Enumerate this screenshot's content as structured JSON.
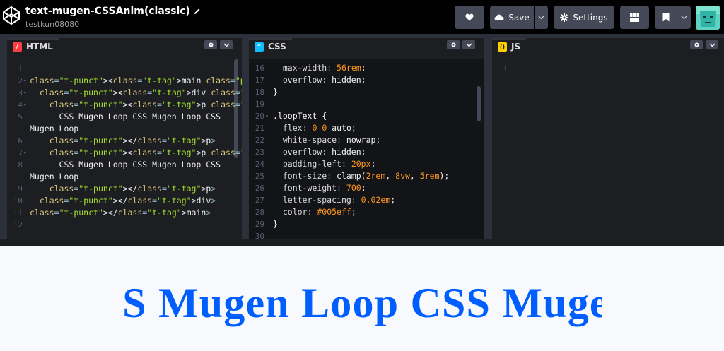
{
  "header": {
    "pen_title": "text-mugen-CSSAnim(classic)",
    "username": "testkun08080",
    "buttons": {
      "love_icon": "heart-icon",
      "save_label": "Save",
      "save_icon": "cloud-icon",
      "settings_label": "Settings",
      "settings_icon": "gear-icon",
      "layout_icon": "layout-grid-icon",
      "bookmark_icon": "bookmark-icon"
    }
  },
  "panes": {
    "html": {
      "label": "HTML",
      "badge": "/",
      "badge_color": "#ff3c41",
      "lines": [
        {
          "n": "1",
          "fold": "",
          "code": ""
        },
        {
          "n": "2",
          "fold": "▾",
          "code": "<main class=\"page\">"
        },
        {
          "n": "3",
          "fold": "▾",
          "code": "  <div class=\"textTrack\">"
        },
        {
          "n": "4",
          "fold": "▾",
          "code": "    <p class=\"loopText textOdd\">"
        },
        {
          "n": "5",
          "fold": "",
          "code": "      CSS Mugen Loop CSS Mugen Loop CSS"
        },
        {
          "n": "",
          "fold": "",
          "code": "Mugen Loop"
        },
        {
          "n": "6",
          "fold": "",
          "code": "    </p>"
        },
        {
          "n": "7",
          "fold": "▾",
          "code": "    <p class=\"loopText textEven\">"
        },
        {
          "n": "8",
          "fold": "",
          "code": "      CSS Mugen Loop CSS Mugen Loop CSS"
        },
        {
          "n": "",
          "fold": "",
          "code": "Mugen Loop"
        },
        {
          "n": "9",
          "fold": "",
          "code": "    </p>"
        },
        {
          "n": "10",
          "fold": "",
          "code": "  </div>"
        },
        {
          "n": "11",
          "fold": "",
          "code": "</main>"
        },
        {
          "n": "12",
          "fold": "",
          "code": ""
        }
      ]
    },
    "css": {
      "label": "CSS",
      "badge": "*",
      "badge_color": "#0ebeff",
      "lines": [
        {
          "n": "16",
          "fold": "",
          "code": "  max-width: 56rem;"
        },
        {
          "n": "17",
          "fold": "",
          "code": "  overflow: hidden;"
        },
        {
          "n": "18",
          "fold": "",
          "code": "}"
        },
        {
          "n": "19",
          "fold": "",
          "code": ""
        },
        {
          "n": "20",
          "fold": "▾",
          "code": ".loopText {"
        },
        {
          "n": "21",
          "fold": "",
          "code": "  flex: 0 0 auto;"
        },
        {
          "n": "22",
          "fold": "",
          "code": "  white-space: nowrap;"
        },
        {
          "n": "23",
          "fold": "",
          "code": "  overflow: hidden;"
        },
        {
          "n": "24",
          "fold": "",
          "code": "  padding-left: 20px;"
        },
        {
          "n": "25",
          "fold": "",
          "code": "  font-size: clamp(2rem, 8vw, 5rem);"
        },
        {
          "n": "26",
          "fold": "",
          "code": "  font-weight: 700;"
        },
        {
          "n": "27",
          "fold": "",
          "code": "  letter-spacing: 0.02em;"
        },
        {
          "n": "28",
          "fold": "",
          "code": "  color: #005eff;"
        },
        {
          "n": "29",
          "fold": "",
          "code": "}"
        },
        {
          "n": "30",
          "fold": "",
          "code": ""
        }
      ]
    },
    "js": {
      "label": "JS",
      "badge": "()",
      "badge_color": "#fcd000",
      "lines": [
        {
          "n": "1",
          "fold": "",
          "code": ""
        }
      ]
    }
  },
  "preview": {
    "text": "CSS Mugen Loop CSS Mugen Loop CSS Mugen Loop",
    "color": "#005eff"
  }
}
